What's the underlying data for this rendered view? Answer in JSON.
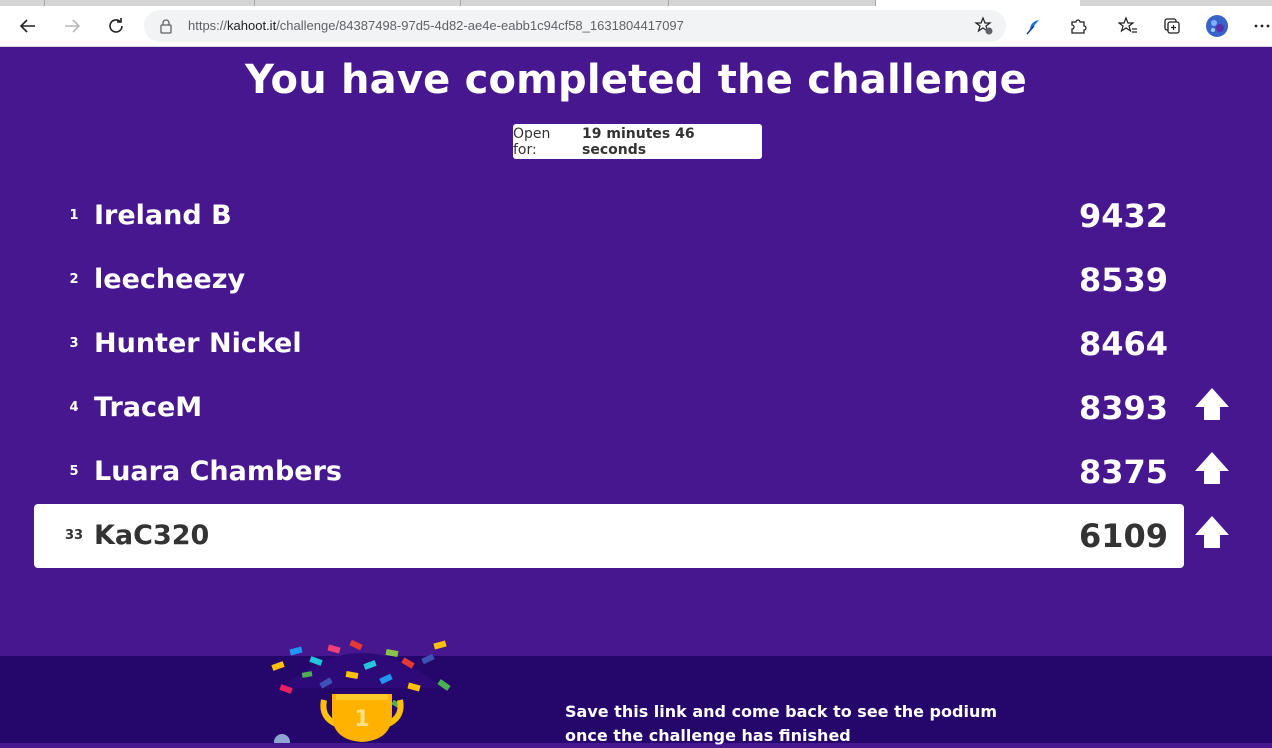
{
  "browser": {
    "url_prefix": "https://",
    "url_host": "kahoot.it",
    "url_path": "/challenge/84387498-97d5-4d82-ae4e-eabb1c94cf58_1631804417097"
  },
  "page": {
    "title": "You have completed the challenge",
    "timer_label": "Open for:",
    "timer_value": "19 minutes 46 seconds"
  },
  "leaderboard": [
    {
      "rank": "1",
      "name": "Ireland B",
      "score": "9432",
      "trend": ""
    },
    {
      "rank": "2",
      "name": "leecheezy",
      "score": "8539",
      "trend": ""
    },
    {
      "rank": "3",
      "name": "Hunter Nickel",
      "score": "8464",
      "trend": ""
    },
    {
      "rank": "4",
      "name": "TraceM",
      "score": "8393",
      "trend": "up-arrow-icon"
    },
    {
      "rank": "5",
      "name": "Luara Chambers",
      "score": "8375",
      "trend": "up-arrow-icon"
    }
  ],
  "my_entry": {
    "rank": "33",
    "name": "KaC320",
    "score": "6109",
    "trend": "up-arrow-icon"
  },
  "footer": {
    "message": "Save this link and come back to see the podium once the challenge has finished",
    "trophy_number": "1"
  },
  "colors": {
    "background": "#46178f",
    "footer": "#25076b",
    "highlight_row": "#ffffff"
  }
}
